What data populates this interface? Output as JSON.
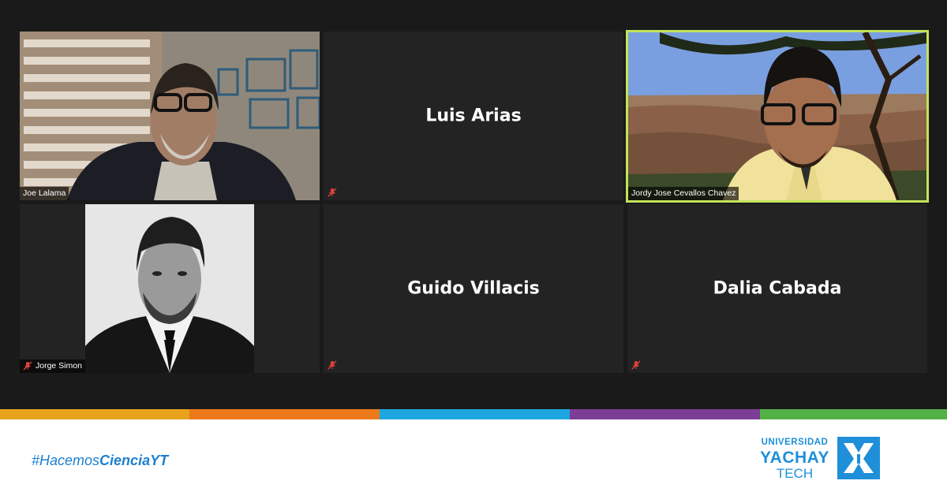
{
  "participants": [
    {
      "name": "Joe Lalama",
      "video": true,
      "muted": false
    },
    {
      "name": "Luis Arias",
      "video": false,
      "muted": true
    },
    {
      "name": "Jordy Jose Cevallos Chavez",
      "video": true,
      "muted": false,
      "active_speaker": true
    },
    {
      "name": "Jorge Simon",
      "video": true,
      "muted": true
    },
    {
      "name": "Guido Villacis",
      "video": false,
      "muted": true
    },
    {
      "name": "Dalia Cabada",
      "video": false,
      "muted": true
    }
  ],
  "footer": {
    "hashtag_prefix": "#Hacemos",
    "hashtag_bold": "CienciaYT",
    "logo_line1": "UNIVERSIDAD",
    "logo_line2": "YACHAY",
    "logo_line3": "TECH"
  },
  "colors": {
    "active_speaker_border": "#c3e35a",
    "muted_icon": "#e0413a",
    "stripe": [
      "#e8a21c",
      "#ec7a1a",
      "#1ea6e0",
      "#7c3d96",
      "#54b146"
    ],
    "brand_blue": "#1e8fd8",
    "hashtag": "#1e7fcf"
  },
  "icons": {
    "muted": "microphone-muted-icon",
    "logo": "yachay-tech-logo-icon"
  }
}
